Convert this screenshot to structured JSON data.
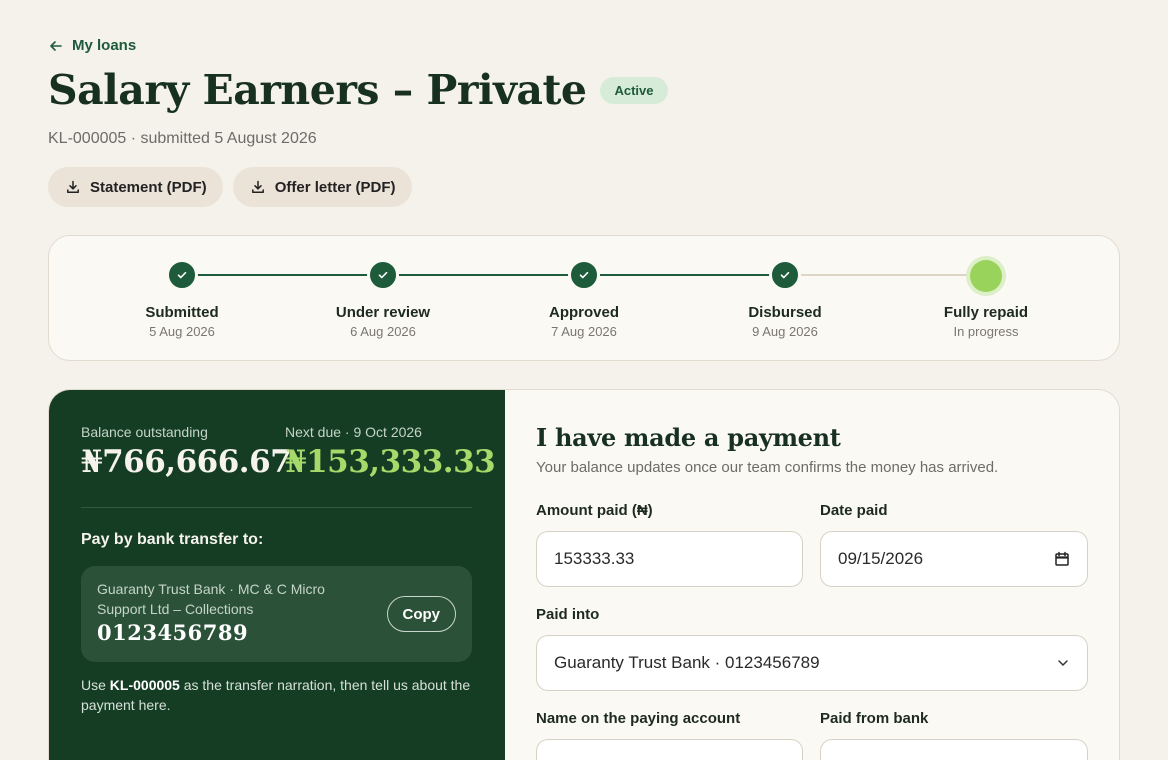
{
  "nav": {
    "back_label": "My loans"
  },
  "loan": {
    "title": "Salary Earners – Private",
    "status": "Active",
    "meta": "KL-000005 · submitted 5 August 2026"
  },
  "actions": {
    "statement_label": "Statement (PDF)",
    "offer_letter_label": "Offer letter (PDF)"
  },
  "stepper": {
    "steps": [
      {
        "label": "Submitted",
        "date": "5 Aug 2026",
        "state": "done"
      },
      {
        "label": "Under review",
        "date": "6 Aug 2026",
        "state": "done"
      },
      {
        "label": "Approved",
        "date": "7 Aug 2026",
        "state": "done"
      },
      {
        "label": "Disbursed",
        "date": "9 Aug 2026",
        "state": "done"
      },
      {
        "label": "Fully repaid",
        "date": "In progress",
        "state": "current"
      }
    ]
  },
  "balance": {
    "outstanding_label": "Balance outstanding",
    "outstanding_value": "₦766,666.67",
    "next_due_label": "Next due · 9 Oct 2026",
    "next_due_value": "₦153,333.33"
  },
  "transfer": {
    "heading": "Pay by bank transfer to:",
    "bank_name": "Guaranty Trust Bank · MC & C Micro Support Ltd – Collections",
    "account_number": "0123456789",
    "copy_label": "Copy",
    "narration_prefix": "Use ",
    "narration_ref": "KL-000005",
    "narration_suffix": " as the transfer narration, then tell us about the payment here."
  },
  "form": {
    "title": "I have made a payment",
    "subtitle": "Your balance updates once our team confirms the money has arrived.",
    "amount_label": "Amount paid (₦)",
    "amount_value": "153333.33",
    "date_label": "Date paid",
    "date_value": "09/15/2026",
    "paid_into_label": "Paid into",
    "paid_into_value": "Guaranty Trust Bank · 0123456789",
    "payer_name_label": "Name on the paying account",
    "payer_bank_label": "Paid from bank"
  },
  "colors": {
    "background": "#f5f1eb",
    "brand_green": "#143d24",
    "accent_lime": "#a6d96a",
    "badge_bg": "#d6ecd8"
  }
}
